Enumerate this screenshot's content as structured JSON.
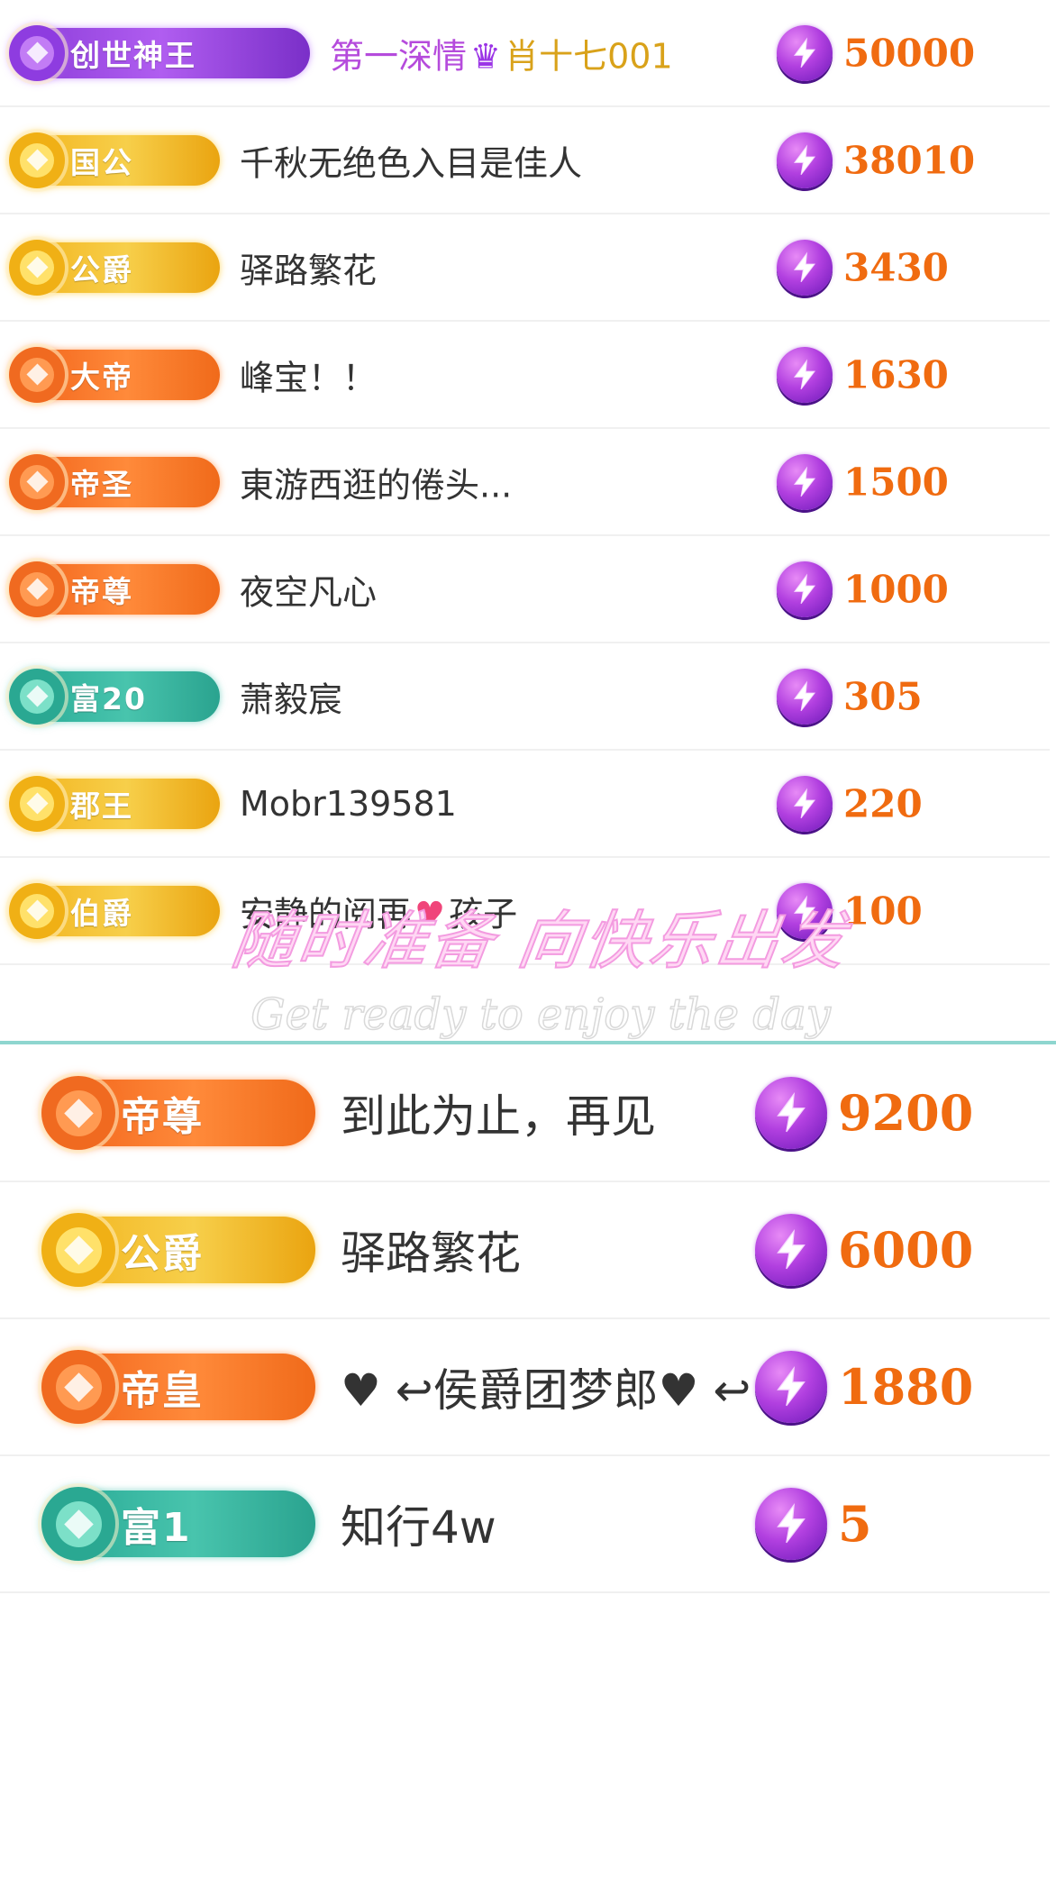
{
  "top_list": [
    {
      "badge": "创世神王",
      "name": "第一深情",
      "name_suffix": "肖十七001",
      "amount": "50000",
      "theme": "purple"
    },
    {
      "badge": "国公",
      "name": "千秋无绝色入目是佳人",
      "amount": "38010",
      "theme": "gold"
    },
    {
      "badge": "公爵",
      "name": "驿路繁花",
      "amount": "3430",
      "theme": "gold"
    },
    {
      "badge": "大帝",
      "name": "峰宝！！",
      "amount": "1630",
      "theme": "orange"
    },
    {
      "badge": "帝圣",
      "name": "東游西逛的倦头...",
      "amount": "1500",
      "theme": "orange"
    },
    {
      "badge": "帝尊",
      "name": "夜空凡心",
      "amount": "1000",
      "theme": "orange"
    },
    {
      "badge": "富20",
      "name": "萧毅宸",
      "amount": "305",
      "theme": "teal"
    },
    {
      "badge": "郡王",
      "name": "Mobr139581",
      "amount": "220",
      "theme": "gold"
    },
    {
      "badge": "伯爵",
      "name": "安静的阅再",
      "name_suffix": "孩子",
      "amount": "100",
      "theme": "gold"
    }
  ],
  "overlay": {
    "cn": "随时准备 向快乐出发",
    "en": "Get ready to enjoy the day"
  },
  "bottom_list": [
    {
      "badge": "帝尊",
      "name": "到此为止，再见",
      "amount": "9200",
      "theme": "orange"
    },
    {
      "badge": "公爵",
      "name": "驿路繁花",
      "amount": "6000",
      "theme": "gold"
    },
    {
      "badge": "帝皇",
      "name": "♥ ↩侯爵团梦郎♥ ↩",
      "amount": "1880",
      "theme": "orange"
    },
    {
      "badge": "富1",
      "name": "知行4w",
      "amount": "5",
      "theme": "teal"
    }
  ],
  "colors": {
    "amount": "#f06b10",
    "divider": "#8ed6cf",
    "purple_name": "#b54bdc",
    "gold_name": "#d9a21a"
  },
  "icons": {
    "coin": "lightning-coin-icon"
  }
}
